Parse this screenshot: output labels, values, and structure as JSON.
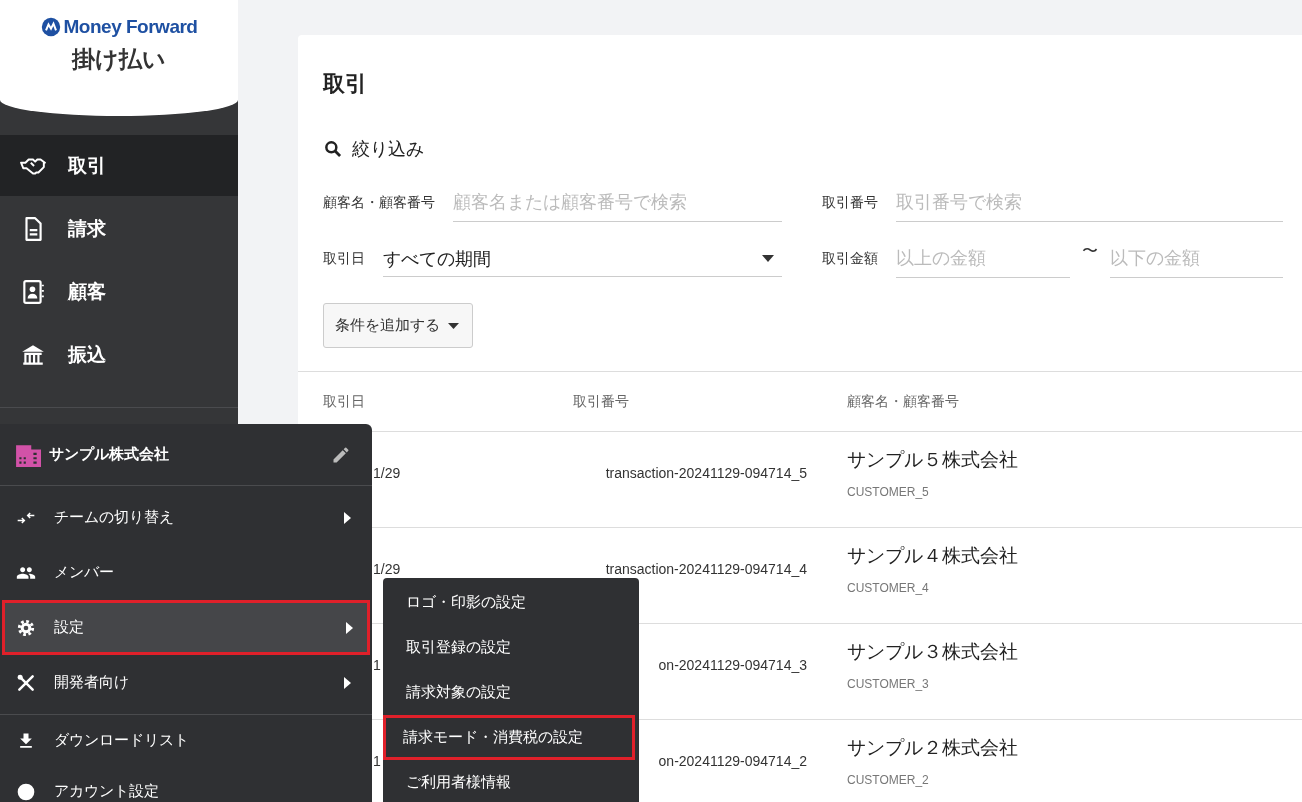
{
  "brand": {
    "logo_text": "Money Forward",
    "product": "掛け払い"
  },
  "nav": [
    {
      "label": "取引",
      "selected": true
    },
    {
      "label": "請求",
      "selected": false
    },
    {
      "label": "顧客",
      "selected": false
    },
    {
      "label": "振込",
      "selected": false
    }
  ],
  "page": {
    "title": "取引",
    "filter": {
      "heading": "絞り込み",
      "customer": {
        "label": "顧客名・顧客番号",
        "placeholder": "顧客名または顧客番号で検索"
      },
      "transaction_no": {
        "label": "取引番号",
        "placeholder": "取引番号で検索"
      },
      "date": {
        "label": "取引日",
        "value": "すべての期間"
      },
      "amount": {
        "label": "取引金額",
        "min_placeholder": "以上の金額",
        "separator": "〜",
        "max_placeholder": "以下の金額"
      },
      "add_condition": "条件を追加する"
    }
  },
  "table": {
    "columns": [
      "取引日",
      "取引番号",
      "顧客名・顧客番号"
    ],
    "rows": [
      {
        "date": "1/29",
        "transaction": "transaction-20241129-094714_5",
        "customer": "サンプル５株式会社",
        "customer_no": "CUSTOMER_5"
      },
      {
        "date": "1/29",
        "transaction": "transaction-20241129-094714_4",
        "customer": "サンプル４株式会社",
        "customer_no": "CUSTOMER_4"
      },
      {
        "date": "1",
        "transaction": "on-20241129-094714_3",
        "customer": "サンプル３株式会社",
        "customer_no": "CUSTOMER_3"
      },
      {
        "date": "1",
        "transaction": "on-20241129-094714_2",
        "customer": "サンプル２株式会社",
        "customer_no": "CUSTOMER_2"
      }
    ]
  },
  "account_menu": {
    "team": "サンプル株式会社",
    "groups": [
      [
        {
          "label": "チームの切り替え",
          "has_submenu": true,
          "highlighted": false
        },
        {
          "label": "メンバー",
          "has_submenu": false,
          "highlighted": false
        },
        {
          "label": "設定",
          "has_submenu": true,
          "highlighted": true
        },
        {
          "label": "開発者向け",
          "has_submenu": true,
          "highlighted": false
        }
      ],
      [
        {
          "label": "ダウンロードリスト",
          "has_submenu": false,
          "highlighted": false
        },
        {
          "label": "アカウント設定",
          "has_submenu": false,
          "highlighted": false
        }
      ]
    ]
  },
  "submenu": {
    "items": [
      {
        "label": "ロゴ・印影の設定",
        "highlighted": false
      },
      {
        "label": "取引登録の設定",
        "highlighted": false
      },
      {
        "label": "請求対象の設定",
        "highlighted": false
      },
      {
        "label": "請求モード・消費税の設定",
        "highlighted": true
      },
      {
        "label": "ご利用者様情報",
        "highlighted": false
      }
    ]
  }
}
